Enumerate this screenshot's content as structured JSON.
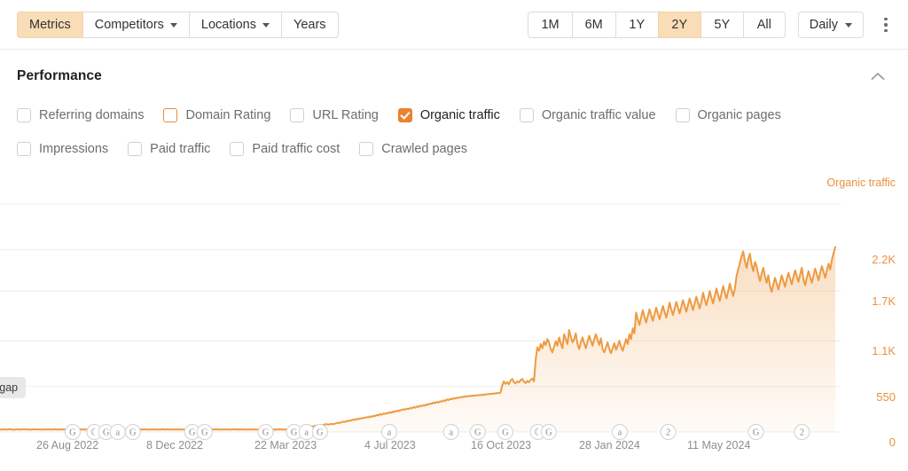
{
  "toolbar": {
    "tabs": [
      {
        "label": "Metrics",
        "active": true,
        "caret": false,
        "name": "tab-metrics"
      },
      {
        "label": "Competitors",
        "active": false,
        "caret": true,
        "name": "tab-competitors"
      },
      {
        "label": "Locations",
        "active": false,
        "caret": true,
        "name": "tab-locations"
      },
      {
        "label": "Years",
        "active": false,
        "caret": false,
        "name": "tab-years"
      }
    ],
    "ranges": [
      {
        "label": "1M",
        "active": false
      },
      {
        "label": "6M",
        "active": false
      },
      {
        "label": "1Y",
        "active": false
      },
      {
        "label": "2Y",
        "active": true
      },
      {
        "label": "5Y",
        "active": false
      },
      {
        "label": "All",
        "active": false
      }
    ],
    "granularity": "Daily",
    "kebab_icon": "more-vertical-icon"
  },
  "performance": {
    "title": "Performance",
    "collapse_icon": "chevron-up-icon",
    "metrics": [
      {
        "label": "Referring domains",
        "state": "unchecked"
      },
      {
        "label": "Domain Rating",
        "state": "outline"
      },
      {
        "label": "URL Rating",
        "state": "unchecked"
      },
      {
        "label": "Organic traffic",
        "state": "checked"
      },
      {
        "label": "Organic traffic value",
        "state": "unchecked"
      },
      {
        "label": "Organic pages",
        "state": "unchecked"
      },
      {
        "label": "Impressions",
        "state": "unchecked"
      },
      {
        "label": "Paid traffic",
        "state": "unchecked"
      },
      {
        "label": "Paid traffic cost",
        "state": "unchecked"
      },
      {
        "label": "Crawled pages",
        "state": "unchecked"
      }
    ]
  },
  "tooltip": {
    "text": "ntent gap"
  },
  "colors": {
    "accent": "#e8832f",
    "line": "#ee9a42",
    "active_tab_bg": "#f9ddb7",
    "axis_text": "#e8923c",
    "grid": "#ededed"
  },
  "chart_data": {
    "type": "area",
    "title": "",
    "legend": "Organic traffic",
    "legend_position": "top-right",
    "grid": true,
    "ylabel": "Organic traffic",
    "xlabel": "",
    "ylim": [
      0,
      2750
    ],
    "ytick_labels": [
      "2.2K",
      "1.7K",
      "1.1K",
      "550",
      "0"
    ],
    "ytick_values": [
      2200,
      1700,
      1100,
      550,
      0
    ],
    "xtick_labels": [
      "26 Aug 2022",
      "8 Dec 2022",
      "22 Mar 2023",
      "4 Jul 2023",
      "16 Oct 2023",
      "28 Jan 2024",
      "11 May 2024"
    ],
    "series": [
      {
        "name": "Organic traffic",
        "color": "#ee9a42",
        "values": [
          30,
          28,
          32,
          30,
          29,
          31,
          33,
          30,
          28,
          30,
          32,
          31,
          29,
          30,
          34,
          32,
          30,
          31,
          29,
          30,
          33,
          31,
          30,
          32,
          30,
          29,
          31,
          30,
          32,
          31,
          30,
          29,
          31,
          33,
          30,
          31,
          30,
          32,
          31,
          30,
          29,
          31,
          30,
          32,
          30,
          31,
          29,
          30,
          32,
          31,
          30,
          29,
          31,
          30,
          32,
          31,
          30,
          29,
          31,
          30,
          32,
          30,
          31,
          29,
          30,
          32,
          31,
          30,
          31,
          29,
          30,
          32,
          31,
          30,
          29,
          31,
          30,
          32,
          31,
          30,
          29,
          31,
          33,
          30,
          31,
          30,
          32,
          31,
          30,
          29,
          31,
          30,
          32,
          30,
          31,
          29,
          30,
          32,
          31,
          30,
          32,
          31,
          30,
          29,
          31,
          30,
          32,
          31,
          30,
          29,
          31,
          30,
          32,
          30,
          31,
          29,
          30,
          32,
          31,
          30,
          29,
          31,
          30,
          32,
          31,
          30,
          31,
          29,
          30,
          32,
          31,
          30,
          29,
          31,
          30,
          32,
          31,
          30,
          29,
          31,
          33,
          30,
          31,
          30,
          32,
          31,
          30,
          29,
          31,
          30,
          32,
          30,
          31,
          29,
          30,
          32,
          31,
          30,
          29,
          31,
          30,
          32,
          31,
          30,
          29,
          31,
          30,
          32,
          31,
          30,
          29,
          31,
          30,
          32,
          30,
          31,
          29,
          30,
          32,
          31,
          38,
          45,
          52,
          60,
          58,
          64,
          70,
          66,
          72,
          78,
          74,
          80,
          86,
          82,
          90,
          95,
          88,
          92,
          98,
          94,
          100,
          105,
          112,
          108,
          118,
          125,
          120,
          132,
          128,
          140,
          138,
          150,
          145,
          158,
          152,
          165,
          160,
          172,
          168,
          180,
          175,
          188,
          182,
          195,
          190,
          205,
          198,
          215,
          208,
          222,
          218,
          230,
          225,
          240,
          232,
          248,
          242,
          258,
          250,
          265,
          262,
          275,
          268,
          282,
          276,
          290,
          285,
          300,
          292,
          308,
          302,
          318,
          310,
          325,
          318,
          335,
          328,
          345,
          338,
          355,
          348,
          362,
          355,
          372,
          365,
          382,
          375,
          392,
          385,
          400,
          394,
          408,
          402,
          415,
          410,
          422,
          418,
          428,
          425,
          432,
          430,
          436,
          434,
          440,
          438,
          444,
          442,
          448,
          445,
          452,
          450,
          458,
          455,
          462,
          460,
          466,
          464,
          470,
          468,
          475,
          560,
          610,
          580,
          600,
          575,
          620,
          640,
          600,
          585,
          612,
          598,
          625,
          640,
          605,
          590,
          618,
          600,
          630,
          645,
          610,
          870,
          1020,
          980,
          1060,
          1010,
          1090,
          1050,
          1120,
          1080,
          1000,
          960,
          1030,
          1095,
          1040,
          1140,
          1070,
          1010,
          1180,
          1120,
          1060,
          1230,
          1150,
          1080,
          1120,
          1190,
          1060,
          1000,
          1080,
          1140,
          1070,
          1010,
          1090,
          1160,
          1100,
          1040,
          1120,
          1180,
          1110,
          1050,
          1130,
          1000,
          960,
          1020,
          1080,
          1000,
          950,
          1010,
          1070,
          990,
          1040,
          1100,
          1030,
          980,
          1050,
          1120,
          1060,
          1180,
          1120,
          1250,
          1190,
          1440,
          1360,
          1290,
          1380,
          1470,
          1390,
          1320,
          1400,
          1480,
          1410,
          1340,
          1420,
          1500,
          1430,
          1360,
          1440,
          1520,
          1450,
          1380,
          1460,
          1560,
          1480,
          1410,
          1490,
          1570,
          1500,
          1430,
          1510,
          1590,
          1520,
          1450,
          1530,
          1610,
          1540,
          1470,
          1550,
          1630,
          1560,
          1490,
          1570,
          1680,
          1600,
          1530,
          1610,
          1700,
          1620,
          1550,
          1640,
          1730,
          1650,
          1580,
          1670,
          1760,
          1680,
          1610,
          1700,
          1790,
          1710,
          1640,
          1730,
          1880,
          1960,
          2040,
          2120,
          2180,
          2060,
          1980,
          2090,
          2150,
          2020,
          1940,
          2050,
          2000,
          1900,
          1820,
          1910,
          1980,
          1880,
          1800,
          1890,
          1760,
          1690,
          1780,
          1860,
          1790,
          1720,
          1810,
          1890,
          1820,
          1750,
          1840,
          1920,
          1850,
          1780,
          1870,
          1950,
          1880,
          1810,
          1900,
          1980,
          1840,
          1770,
          1860,
          1940,
          1870,
          1800,
          1890,
          1970,
          1900,
          1830,
          1920,
          2000,
          1930,
          1860,
          1950,
          2030,
          1960,
          2080,
          2160,
          2230
        ]
      }
    ],
    "annotations": [
      {
        "glyph": "G",
        "x_ratio": 0.087
      },
      {
        "glyph": "☾",
        "x_ratio": 0.113
      },
      {
        "glyph": "G",
        "x_ratio": 0.127
      },
      {
        "glyph": "a",
        "x_ratio": 0.141
      },
      {
        "glyph": "G",
        "x_ratio": 0.159
      },
      {
        "glyph": "G",
        "x_ratio": 0.23
      },
      {
        "glyph": "G",
        "x_ratio": 0.245
      },
      {
        "glyph": "G",
        "x_ratio": 0.318
      },
      {
        "glyph": "G",
        "x_ratio": 0.352
      },
      {
        "glyph": "a",
        "x_ratio": 0.367
      },
      {
        "glyph": "G",
        "x_ratio": 0.383
      },
      {
        "glyph": "a",
        "x_ratio": 0.466
      },
      {
        "glyph": "a",
        "x_ratio": 0.54
      },
      {
        "glyph": "G",
        "x_ratio": 0.572
      },
      {
        "glyph": "G",
        "x_ratio": 0.605
      },
      {
        "glyph": "☾",
        "x_ratio": 0.644
      },
      {
        "glyph": "G",
        "x_ratio": 0.657
      },
      {
        "glyph": "a",
        "x_ratio": 0.742
      },
      {
        "glyph": "2",
        "x_ratio": 0.8
      },
      {
        "glyph": "G",
        "x_ratio": 0.905
      },
      {
        "glyph": "2",
        "x_ratio": 0.96
      }
    ]
  }
}
